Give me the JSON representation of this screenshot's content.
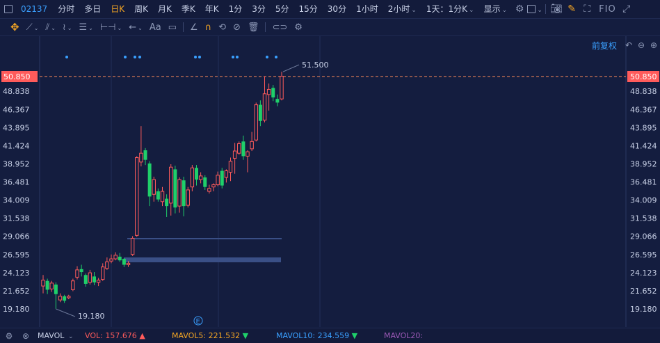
{
  "top_toolbar": {
    "stock_code": "02137",
    "periods": [
      {
        "label": "分时",
        "active": false,
        "dropdown": false
      },
      {
        "label": "多日",
        "active": false,
        "dropdown": false
      },
      {
        "label": "日K",
        "active": true,
        "dropdown": false
      },
      {
        "label": "周K",
        "active": false,
        "dropdown": false
      },
      {
        "label": "月K",
        "active": false,
        "dropdown": false
      },
      {
        "label": "季K",
        "active": false,
        "dropdown": false
      },
      {
        "label": "年K",
        "active": false,
        "dropdown": false
      },
      {
        "label": "1分",
        "active": false,
        "dropdown": false
      },
      {
        "label": "3分",
        "active": false,
        "dropdown": false
      },
      {
        "label": "5分",
        "active": false,
        "dropdown": false
      },
      {
        "label": "15分",
        "active": false,
        "dropdown": false
      },
      {
        "label": "30分",
        "active": false,
        "dropdown": false
      },
      {
        "label": "1小时",
        "active": false,
        "dropdown": false
      },
      {
        "label": "2小时",
        "active": false,
        "dropdown": true
      },
      {
        "label": "1天：1分K",
        "active": false,
        "dropdown": true
      },
      {
        "label": "显示",
        "active": false,
        "dropdown": true
      }
    ],
    "fio_label": "FIO",
    "accent_color": "#f5a623",
    "code_color": "#3aa0ff"
  },
  "draw_toolbar": {
    "font_tool_label": "Aa"
  },
  "sub_bar": {
    "adjust_label": "前复权"
  },
  "chart": {
    "price_axis_labels": [
      "50.850",
      "48.838",
      "46.367",
      "43.895",
      "41.424",
      "38.952",
      "36.481",
      "34.009",
      "31.538",
      "29.066",
      "26.595",
      "24.123",
      "21.652",
      "19.180"
    ],
    "current_price_label": "50.850",
    "high_annotation": "51.500",
    "low_annotation": "19.180",
    "event_marker": "E",
    "up_color": "#ff5b5b",
    "down_color": "#1fcf6a",
    "bg_color": "#141d3f"
  },
  "chart_data": {
    "type": "candlestick",
    "y_range": [
      17.9,
      52.3
    ],
    "last_price": 50.85,
    "max_price": 51.5,
    "min_price": 19.18,
    "candles": [
      {
        "o": 22.3,
        "c": 23.1,
        "h": 23.8,
        "l": 21.3
      },
      {
        "o": 23.0,
        "c": 21.8,
        "h": 23.3,
        "l": 21.2
      },
      {
        "o": 21.9,
        "c": 22.7,
        "h": 23.0,
        "l": 21.5
      },
      {
        "o": 22.5,
        "c": 21.2,
        "h": 22.8,
        "l": 19.2
      },
      {
        "o": 20.4,
        "c": 20.9,
        "h": 21.3,
        "l": 20.1
      },
      {
        "o": 20.9,
        "c": 20.3,
        "h": 21.1,
        "l": 20.0
      },
      {
        "o": 20.7,
        "c": 20.9,
        "h": 21.1,
        "l": 20.5
      },
      {
        "o": 21.8,
        "c": 23.0,
        "h": 23.3,
        "l": 21.6
      },
      {
        "o": 23.5,
        "c": 24.5,
        "h": 25.0,
        "l": 23.2
      },
      {
        "o": 24.6,
        "c": 24.2,
        "h": 25.2,
        "l": 23.6
      },
      {
        "o": 23.8,
        "c": 22.6,
        "h": 24.0,
        "l": 22.2
      },
      {
        "o": 22.8,
        "c": 24.1,
        "h": 24.5,
        "l": 22.5
      },
      {
        "o": 23.6,
        "c": 22.8,
        "h": 24.2,
        "l": 22.4
      },
      {
        "o": 22.8,
        "c": 23.1,
        "h": 23.4,
        "l": 22.3
      },
      {
        "o": 23.2,
        "c": 24.9,
        "h": 25.4,
        "l": 23.0
      },
      {
        "o": 24.7,
        "c": 25.6,
        "h": 26.2,
        "l": 24.5
      },
      {
        "o": 25.7,
        "c": 26.0,
        "h": 26.6,
        "l": 25.4
      },
      {
        "o": 26.0,
        "c": 26.5,
        "h": 26.9,
        "l": 25.8
      },
      {
        "o": 26.3,
        "c": 25.8,
        "h": 26.8,
        "l": 25.6
      },
      {
        "o": 26.0,
        "c": 25.2,
        "h": 26.1,
        "l": 24.9
      },
      {
        "o": 25.2,
        "c": 25.4,
        "h": 25.7,
        "l": 24.9
      },
      {
        "o": 26.6,
        "c": 28.8,
        "h": 29.1,
        "l": 26.4
      },
      {
        "o": 29.2,
        "c": 39.8,
        "h": 40.0,
        "l": 29.0
      },
      {
        "o": 39.2,
        "c": 40.4,
        "h": 44.1,
        "l": 38.6
      },
      {
        "o": 40.8,
        "c": 39.5,
        "h": 41.1,
        "l": 38.8
      },
      {
        "o": 39.0,
        "c": 34.5,
        "h": 39.3,
        "l": 33.2
      },
      {
        "o": 34.8,
        "c": 36.8,
        "h": 37.2,
        "l": 33.8
      },
      {
        "o": 35.2,
        "c": 34.1,
        "h": 35.6,
        "l": 33.8
      },
      {
        "o": 33.8,
        "c": 35.2,
        "h": 35.8,
        "l": 33.2
      },
      {
        "o": 34.2,
        "c": 33.2,
        "h": 34.8,
        "l": 31.7
      },
      {
        "o": 33.6,
        "c": 38.5,
        "h": 38.9,
        "l": 31.9
      },
      {
        "o": 38.2,
        "c": 33.0,
        "h": 38.7,
        "l": 32.2
      },
      {
        "o": 33.2,
        "c": 36.8,
        "h": 37.1,
        "l": 32.3
      },
      {
        "o": 36.7,
        "c": 33.2,
        "h": 37.2,
        "l": 31.8
      },
      {
        "o": 33.3,
        "c": 35.4,
        "h": 35.8,
        "l": 33.0
      },
      {
        "o": 35.8,
        "c": 38.4,
        "h": 38.8,
        "l": 35.2
      },
      {
        "o": 38.4,
        "c": 36.8,
        "h": 38.8,
        "l": 36.0
      },
      {
        "o": 36.8,
        "c": 37.3,
        "h": 37.8,
        "l": 36.3
      },
      {
        "o": 37.1,
        "c": 35.8,
        "h": 37.4,
        "l": 35.4
      },
      {
        "o": 35.2,
        "c": 35.6,
        "h": 36.1,
        "l": 34.9
      },
      {
        "o": 35.8,
        "c": 36.1,
        "h": 36.3,
        "l": 35.2
      },
      {
        "o": 36.1,
        "c": 37.4,
        "h": 37.9,
        "l": 35.9
      },
      {
        "o": 38.0,
        "c": 36.0,
        "h": 38.4,
        "l": 35.6
      },
      {
        "o": 37.1,
        "c": 38.0,
        "h": 38.2,
        "l": 36.4
      },
      {
        "o": 37.8,
        "c": 39.3,
        "h": 39.8,
        "l": 36.6
      },
      {
        "o": 39.7,
        "c": 40.7,
        "h": 41.8,
        "l": 37.6
      },
      {
        "o": 40.4,
        "c": 41.7,
        "h": 42.0,
        "l": 40.2
      },
      {
        "o": 42.0,
        "c": 40.0,
        "h": 42.8,
        "l": 39.5
      },
      {
        "o": 40.0,
        "c": 40.6,
        "h": 40.8,
        "l": 37.8
      },
      {
        "o": 41.0,
        "c": 42.0,
        "h": 43.3,
        "l": 40.7
      },
      {
        "o": 42.2,
        "c": 47.0,
        "h": 47.3,
        "l": 42.0
      },
      {
        "o": 47.0,
        "c": 44.8,
        "h": 47.6,
        "l": 44.1
      },
      {
        "o": 44.9,
        "c": 48.5,
        "h": 50.9,
        "l": 44.6
      },
      {
        "o": 48.4,
        "c": 49.1,
        "h": 49.9,
        "l": 46.2
      },
      {
        "o": 49.3,
        "c": 48.0,
        "h": 49.7,
        "l": 47.5
      },
      {
        "o": 47.8,
        "c": 47.3,
        "h": 48.4,
        "l": 46.8
      },
      {
        "o": 47.8,
        "c": 50.9,
        "h": 51.5,
        "l": 47.6
      }
    ]
  },
  "volume_bar": {
    "indicator": "MAVOL",
    "vol_label": "VOL: 157.676",
    "mavol5_label": "MAVOL5: 221.532",
    "mavol10_label": "MAVOL10: 234.559",
    "mavol20_label": "MAVOL20:"
  }
}
